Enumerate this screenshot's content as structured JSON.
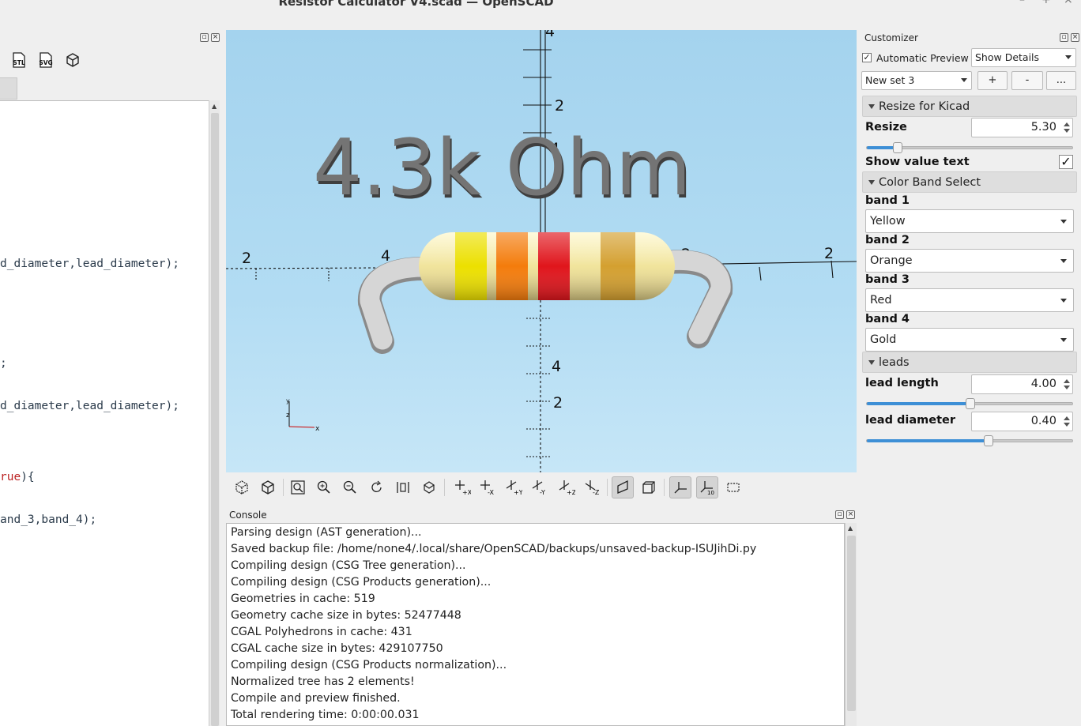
{
  "window": {
    "title": "Resistor Calculator V4.scad — OpenSCAD",
    "minimize": "–",
    "maximize": "+",
    "close": "×"
  },
  "editor": {
    "toolbar": [
      "stl-export-icon",
      "svg-export-icon",
      "3d-view-icon"
    ],
    "stl_label": "STL",
    "svg_label": "SVG",
    "lines": [
      {
        "text": "d_diameter,lead_diameter);"
      },
      {
        "text": ";"
      },
      {
        "text": "d_diameter,lead_diameter);"
      },
      {
        "pre": "rue",
        "post": "){"
      },
      {
        "text": "and_3,band_4);"
      }
    ]
  },
  "viewport": {
    "value_text": "4.3k Ohm",
    "axis_ticks": [
      "4",
      "2",
      "4",
      "2",
      "4",
      "2",
      "2",
      "4",
      "2"
    ],
    "gizmo": {
      "x": "x",
      "y": "y",
      "z": "z"
    },
    "resistor": {
      "body_color": "#f7ecaa",
      "bands": [
        {
          "name": "Yellow",
          "color": "#ece000"
        },
        {
          "name": "Orange",
          "color": "#f47c0c"
        },
        {
          "name": "Red",
          "color": "#e0151c"
        },
        {
          "name": "Gold",
          "color": "#d4a030"
        }
      ],
      "lead_color": "#cfcfcf"
    }
  },
  "view_toolbar": {
    "buttons": [
      "preview-icon",
      "render-icon",
      "zoom-all-icon",
      "zoom-in-icon",
      "zoom-out-icon",
      "reset-view-icon",
      "view-all-icon",
      "diagonal-view-icon",
      "view-right-icon",
      "view-left-icon",
      "view-back-icon",
      "view-front-icon",
      "view-top-icon",
      "view-bottom-icon",
      "perspective-icon",
      "orthogonal-icon",
      "show-axes-icon",
      "show-scale-icon",
      "show-edges-icon"
    ],
    "labels": {
      "right": "+X",
      "left": "-X",
      "back": "+Y",
      "front": "-Y",
      "top": "+Z",
      "bottom": "-Z",
      "scale": "10"
    }
  },
  "console": {
    "title": "Console",
    "lines": [
      "Parsing design (AST generation)...",
      "Saved backup file: /home/none4/.local/share/OpenSCAD/backups/unsaved-backup-ISUJihDi.py",
      "Compiling design (CSG Tree generation)...",
      "Compiling design (CSG Products generation)...",
      "Geometries in cache: 519",
      "Geometry cache size in bytes: 52477448",
      "CGAL Polyhedrons in cache: 431",
      "CGAL cache size in bytes: 429107750",
      "Compiling design (CSG Products normalization)...",
      "Normalized tree has 2 elements!",
      "Compile and preview finished.",
      "Total rendering time: 0:00:00.031"
    ]
  },
  "customizer": {
    "title": "Customizer",
    "automatic_preview": {
      "label": "Automatic Preview",
      "checked": true,
      "mark": "✓"
    },
    "details_select": "Show Details",
    "preset_select": "New set 3",
    "preset_buttons": [
      "+",
      "-",
      "..."
    ],
    "sections": {
      "resize": {
        "title": "Resize for Kicad",
        "resize_label": "Resize",
        "resize_value": "5.30",
        "resize_fraction": 0.13,
        "show_value_label": "Show value text",
        "show_value_checked": true,
        "check_mark": "✓"
      },
      "bands": {
        "title": "Color Band Select",
        "items": [
          {
            "label": "band 1",
            "value": "Yellow"
          },
          {
            "label": "band 2",
            "value": "Orange"
          },
          {
            "label": "band 3",
            "value": "Red"
          },
          {
            "label": "band 4",
            "value": "Gold"
          }
        ]
      },
      "leads": {
        "title": "leads",
        "length_label": "lead length",
        "length_value": "4.00",
        "length_fraction": 0.5,
        "diameter_label": "lead diameter",
        "diameter_value": "0.40",
        "diameter_fraction": 0.59
      }
    }
  },
  "colors": {
    "accent": "#3d8fd6",
    "viewport_top": "#a4d3ee",
    "viewport_bottom": "#c6e6f7"
  }
}
